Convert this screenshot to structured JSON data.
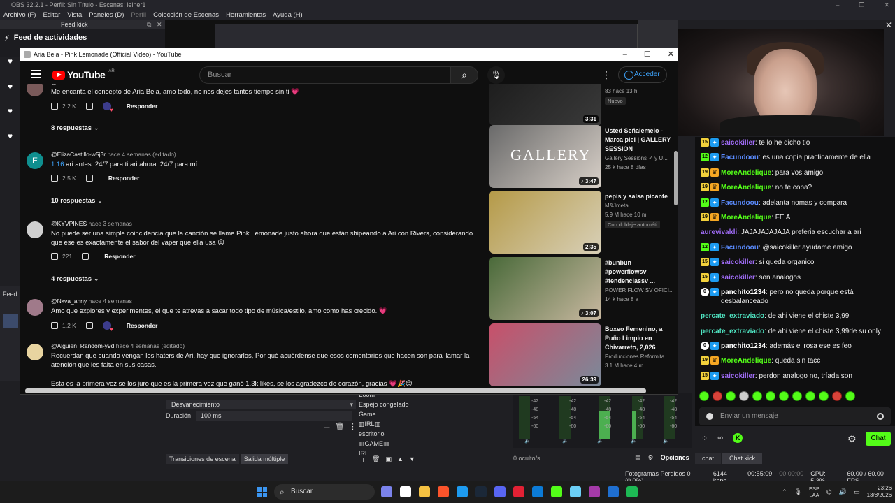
{
  "obs": {
    "title": "OBS 32.2.1 - Perfil: Sin Título - Escenas: leiner1",
    "menu": [
      {
        "label": "Archivo (F)",
        "disabled": false
      },
      {
        "label": "Editar",
        "disabled": false
      },
      {
        "label": "Vista",
        "disabled": false
      },
      {
        "label": "Paneles (D)",
        "disabled": false
      },
      {
        "label": "Perfil",
        "disabled": true
      },
      {
        "label": "Colección de Escenas",
        "disabled": false
      },
      {
        "label": "Herramientas",
        "disabled": false
      },
      {
        "label": "Ayuda (H)",
        "disabled": false
      }
    ],
    "feed_kick_title": "Feed kick",
    "feed_heading": "Feed de actividades",
    "left_dock_label": "Feed",
    "transition": {
      "header": "Transiciones de escena",
      "type": "Desvanecimiento",
      "duration_label": "Duración",
      "duration_value": "100 ms",
      "tabs": [
        "Transiciones de escena",
        "Salida múltiple"
      ]
    },
    "sources": [
      "Zoom",
      "Espejo congelado",
      "Game",
      "▥IRL▥",
      "escritorio",
      "▥GAME▥",
      "IRL"
    ],
    "mixer": {
      "db_labels": [
        "-42",
        "-48",
        "-54",
        "-60"
      ],
      "hidden": "0 oculto/s",
      "options_label": "Opciones"
    },
    "status": {
      "dropped": "Fotogramas Perdidos 0 (0.0%)",
      "bitrate": "6144 kbps",
      "live": "00:55:09",
      "rec": "00:00:00",
      "cpu": "CPU: 5.3%",
      "fps": "60.00 / 60.00 FPS"
    }
  },
  "youtube": {
    "window_title": "Aria Bela - Pink Lemonade (Official Video) - YouTube",
    "logo": "YouTube",
    "region": "AR",
    "search_placeholder": "Buscar",
    "signin": "Acceder",
    "comments": [
      {
        "author": "@...",
        "when": "",
        "text": "Me encanta el concepto de Aria Bela, amo todo, no nos dejes tantos tiempo sin ti 💗",
        "likes": "2.2 K",
        "hearted": true,
        "reply": "Responder",
        "replies": "8 respuestas"
      },
      {
        "author": "@ElizaCastillo-w5j3r",
        "when": "hace 4 semanas (editado)",
        "timestamp": "1:16",
        "text": "ari antes: 24/7 para ti ari ahora: 24/7 para mí",
        "likes": "2.5 K",
        "hearted": false,
        "reply": "Responder",
        "replies": "10 respuestas",
        "avatar_letter": "E"
      },
      {
        "author": "@KYVPINES",
        "when": "hace 3 semanas",
        "text": "No puede ser una simple coincidencia que la canción se llame Pink Lemonade justo ahora que están shipeando a Ari con Rivers, considerando que ese es exactamente el sabor del vaper que ella  usa 😩",
        "likes": "221",
        "hearted": false,
        "reply": "Responder",
        "replies": "4 respuestas"
      },
      {
        "author": "@Nxva_anny",
        "when": "hace 4 semanas",
        "text": "Amo que explores y experimentes, el que te atrevas a sacar todo tipo de música/estilo, amo como has crecido. 💗",
        "likes": "1.2 K",
        "hearted": true,
        "reply": "Responder"
      },
      {
        "author": "@Alguien_Random-y9d",
        "when": "hace 4 semanas (editado)",
        "text": "Recuerdan que cuando vengan los haters de Ari, hay que ignorarlos, Por qué acuérdense que esos comentarios que hacen son para llamar la atención que les falta en sus casas.",
        "text2": "Esta es la primera vez se los juro que es la primera vez que ganó 1.3k likes, se los agradezco de corazón, gracias 💗🎉😊"
      }
    ],
    "videos": [
      {
        "title": "",
        "channel": "",
        "meta": "83  hace 13 h",
        "badge": "Nuevo",
        "duration": "3:31",
        "colors": [
          "#1a1a1a",
          "#3a3a3a"
        ]
      },
      {
        "title": "Usted Señalemelo - Marca piel | GALLERY SESSION",
        "channel": "Gallery Sessions ✓ y U...",
        "meta": "25 k  hace 8 días",
        "duration": "♪ 3:47",
        "thumb_text": "GALLERY",
        "colors": [
          "#6a6a6a",
          "#d8d0c8"
        ]
      },
      {
        "title": "pepis y salsa picante",
        "channel": "M&Jmetal",
        "meta": "5.9 M  hace 10 m",
        "badge": "Con doblaje automáti",
        "duration": "2:35",
        "colors": [
          "#b59a48",
          "#d8d0b8"
        ]
      },
      {
        "title": "#bunbun #powerflowsv #tendenciassv ...",
        "channel": "POWER FLOW SV OFICI...",
        "meta": "14 k  hace 8 a",
        "duration": "♪ 3:07",
        "colors": [
          "#4a6a3a",
          "#c8b8a0"
        ]
      },
      {
        "title": "Boxeo Femenino, a Puño Limpio en Chivarreto,  2,026",
        "channel": "Producciones Reformita",
        "meta": "3.1 M  hace 4 m",
        "duration": "26:39",
        "colors": [
          "#c8506a",
          "#7a8a9a"
        ]
      }
    ]
  },
  "chat": {
    "messages": [
      {
        "badges": [
          "15"
        ],
        "sub": true,
        "crown": false,
        "name": "saicokiller",
        "color": "#a06cf7",
        "text": "te lo he dicho tio"
      },
      {
        "badges": [
          "12"
        ],
        "sub": true,
        "crown": false,
        "name": "Facundoou",
        "color": "#5b8cff",
        "text": "es una copia practicamente de ella"
      },
      {
        "badges": [
          "19"
        ],
        "sub": false,
        "crown": true,
        "name": "MoreAndelique",
        "color": "#53fc18",
        "text": "para vos amigo"
      },
      {
        "badges": [
          "19"
        ],
        "sub": false,
        "crown": true,
        "name": "MoreAndelique",
        "color": "#53fc18",
        "text": "no te copa?"
      },
      {
        "badges": [
          "12"
        ],
        "sub": true,
        "crown": false,
        "name": "Facundoou",
        "color": "#5b8cff",
        "text": "adelanta nomas y compara"
      },
      {
        "badges": [
          "19"
        ],
        "sub": false,
        "crown": true,
        "name": "MoreAndelique",
        "color": "#53fc18",
        "text": "FE A"
      },
      {
        "badges": [],
        "sub": false,
        "crown": false,
        "name": "aurevivaldi",
        "color": "#a06cf7",
        "text": "JAJAJAJAJAJA preferia escuchar a ari"
      },
      {
        "badges": [
          "12"
        ],
        "sub": true,
        "crown": false,
        "name": "Facundoou",
        "color": "#5b8cff",
        "text": "@saicokiller ayudame amigo"
      },
      {
        "badges": [
          "15"
        ],
        "sub": true,
        "crown": false,
        "name": "saicokiller",
        "color": "#a06cf7",
        "text": "si queda organico"
      },
      {
        "badges": [
          "15"
        ],
        "sub": true,
        "crown": false,
        "name": "saicokiller",
        "color": "#a06cf7",
        "text": "son analogos"
      },
      {
        "badges": [
          "0"
        ],
        "sub": true,
        "crown": false,
        "name": "panchito1234",
        "color": "#ffffff",
        "text": "pero no queda porque está desbalanceado"
      },
      {
        "badges": [],
        "sub": false,
        "crown": false,
        "name": "percate_extraviado",
        "color": "#4fe3c1",
        "text": "de ahi viene el chiste 3,99"
      },
      {
        "badges": [],
        "sub": false,
        "crown": false,
        "name": "percate_extraviado",
        "color": "#4fe3c1",
        "text": "de ahi viene el chiste 3,99de su only"
      },
      {
        "badges": [
          "0"
        ],
        "sub": true,
        "crown": false,
        "name": "panchito1234",
        "color": "#ffffff",
        "text": "además el rosa ese es feo"
      },
      {
        "badges": [
          "19"
        ],
        "sub": false,
        "crown": true,
        "name": "MoreAndelique",
        "color": "#53fc18",
        "text": "queda sin tacc"
      },
      {
        "badges": [
          "15"
        ],
        "sub": true,
        "crown": false,
        "name": "saicokiller",
        "color": "#a06cf7",
        "text": "perdon analogo no, tríada son"
      }
    ],
    "input_placeholder": "Enviar un mensaje",
    "send_label": "Chat",
    "tabs": [
      "chat",
      "Chat kick"
    ]
  },
  "taskbar": {
    "search": "Buscar",
    "lang_top": "ESP",
    "lang_bottom": "LAA",
    "time": "23:26",
    "date": "13/8/2026",
    "icon_colors": [
      "#7b83eb",
      "#ffffff",
      "#f5c242",
      "#fb542b",
      "#1d9bf0",
      "#1b2838",
      "#5865f2",
      "#e22134",
      "#0c7bd6",
      "#53fc18",
      "#6ccff6",
      "#a43aa8",
      "#1f6fd0",
      "#1db954"
    ]
  }
}
